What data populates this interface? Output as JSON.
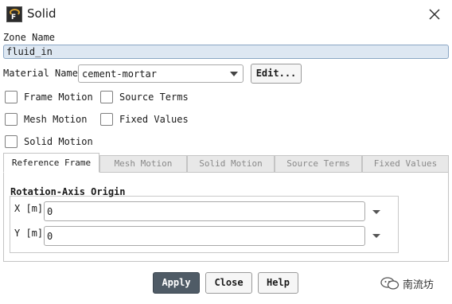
{
  "window": {
    "title": "Solid",
    "icon_name": "fluent-app-icon",
    "icon_letter": "F"
  },
  "zone": {
    "label": "Zone Name",
    "value": "fluid_in"
  },
  "material": {
    "label": "Material Name",
    "selected": "cement-mortar",
    "edit_label": "Edit..."
  },
  "options": {
    "frame_motion": {
      "label": "Frame Motion",
      "checked": false
    },
    "source_terms": {
      "label": "Source Terms",
      "checked": false
    },
    "mesh_motion": {
      "label": "Mesh Motion",
      "checked": false
    },
    "fixed_values": {
      "label": "Fixed Values",
      "checked": false
    },
    "solid_motion": {
      "label": "Solid Motion",
      "checked": false
    }
  },
  "tabs": [
    {
      "label": "Reference Frame",
      "active": true
    },
    {
      "label": "Mesh Motion",
      "active": false
    },
    {
      "label": "Solid Motion",
      "active": false
    },
    {
      "label": "Source Terms",
      "active": false
    },
    {
      "label": "Fixed Values",
      "active": false
    }
  ],
  "rotation_origin": {
    "title": "Rotation-Axis Origin",
    "x_label": "X [m]",
    "x_value": "0",
    "y_label": "Y [m]",
    "y_value": "0"
  },
  "buttons": {
    "apply": "Apply",
    "close": "Close",
    "help": "Help"
  },
  "watermark": {
    "text": "南流坊",
    "icon_name": "wechat-icon"
  },
  "colors": {
    "apply_bg": "#4f5b66",
    "zone_field_bg": "#dde7f2",
    "tab_inactive_bg": "#e8e8e8"
  }
}
